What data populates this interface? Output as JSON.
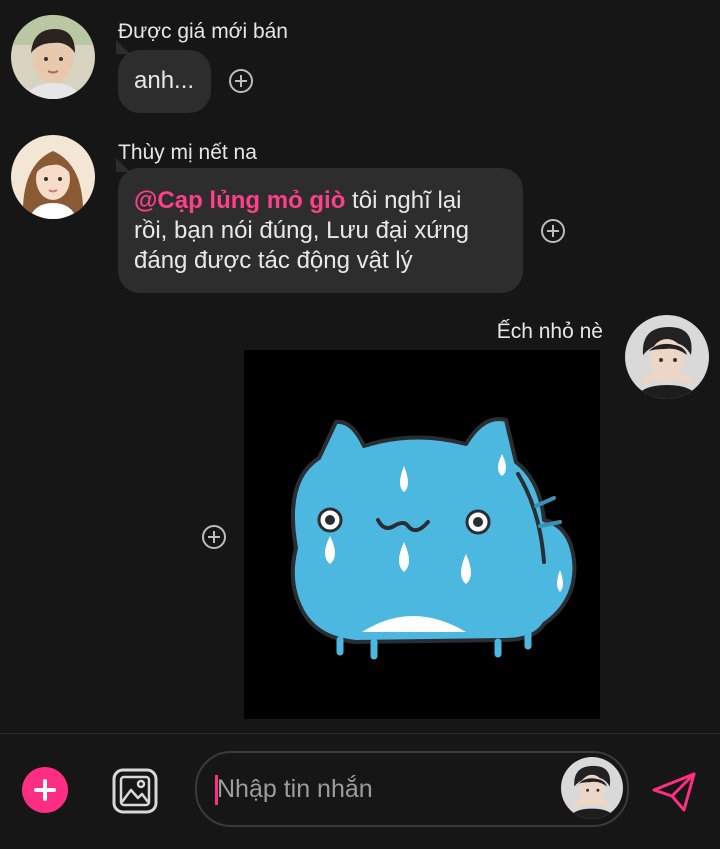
{
  "messages": [
    {
      "sender": "Được giá mới bán",
      "text": "anh..."
    },
    {
      "sender": "Thùy mị nết na",
      "mention": "@Cạp lủng mỏ giò",
      "text_line1": " tôi nghĩ lại",
      "text_line2": "rồi, bạn nói đúng, Lưu đại xứng",
      "text_line3": "đáng được tác động vật lý"
    },
    {
      "sender": "Ếch nhỏ nè",
      "sticker": "crying-blue-cat-sticker"
    }
  ],
  "composer": {
    "placeholder": "Nhập tin nhắn"
  },
  "icons": {
    "add": "plus-icon",
    "image": "image-icon",
    "send": "send-icon",
    "reaction": "add-reaction-icon"
  },
  "colors": {
    "background": "#161616",
    "bubble": "#2d2d2d",
    "accent": "#ff2e82",
    "mention": "#ff3f8a"
  }
}
